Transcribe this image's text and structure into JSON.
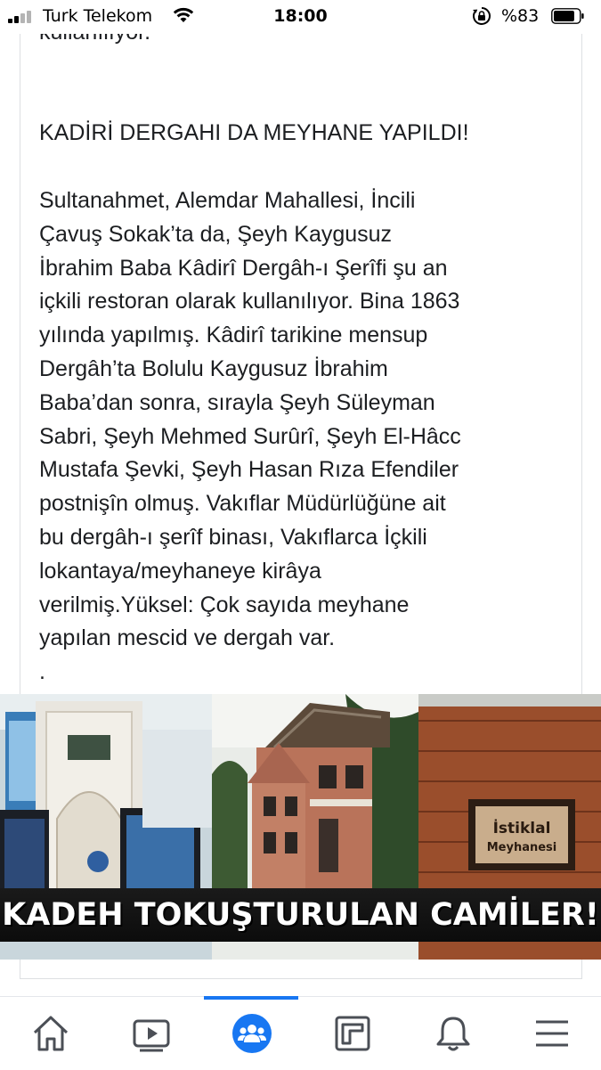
{
  "status_bar": {
    "carrier": "Turk Telekom",
    "time": "18:00",
    "battery_percent": "%83",
    "battery_level": 0.83
  },
  "post": {
    "cut_off_line": "kullanılıyor.",
    "headline": "KADİRİ DERGAHI DA MEYHANE YAPILDI!",
    "body_lines": [
      "Sultanahmet, Alemdar Mahallesi, İncili",
      "Çavuş Sokak’ta da, Şeyh Kaygusuz",
      "İbrahim Baba Kâdirî Dergâh-ı Şerîfi şu an",
      "içkili restoran olarak kullanılıyor. Bina 1863",
      "yılında yapılmış. Kâdirî tarikine mensup",
      "Dergâh’ta Bolulu Kaygusuz İbrahim",
      "Baba’dan sonra, sırayla Şeyh Süleyman",
      "Sabri, Şeyh Mehmed Surûrî, Şeyh El-Hâcc",
      "Mustafa Şevki, Şeyh Hasan Rıza Efendiler",
      "postnişîn olmuş. Vakıflar Müdürlüğüne ait",
      "bu dergâh-ı şerîf binası, Vakıflarca İçkili",
      "lokantaya/meyhaneye kirâya",
      "verilmiş.Yüksel: Çok sayıda meyhane",
      "yapılan mescid ve dergah var.",
      "."
    ]
  },
  "image": {
    "caption": "KADEH TOKUŞTURULAN CAMİLER!",
    "sign_line1": "İstiklal",
    "sign_line2": "Meyhanesi"
  },
  "tabbar": {
    "tabs": [
      {
        "icon": "home-icon",
        "active": false
      },
      {
        "icon": "video-icon",
        "active": false
      },
      {
        "icon": "groups-icon",
        "active": true
      },
      {
        "icon": "pages-icon",
        "active": false
      },
      {
        "icon": "notifications-bell-icon",
        "active": false
      },
      {
        "icon": "menu-icon",
        "active": false
      }
    ]
  },
  "colors": {
    "accent": "#1877f2",
    "text": "#1c1e21",
    "icon_inactive": "#4b4f56"
  }
}
